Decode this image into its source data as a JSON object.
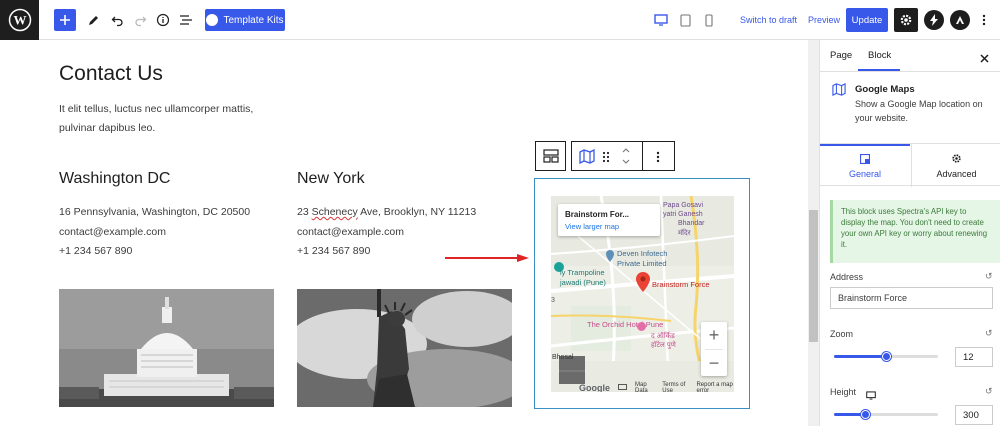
{
  "topbar": {
    "template_kits_label": "Template Kits",
    "switch_to_draft": "Switch to draft",
    "preview": "Preview",
    "update": "Update"
  },
  "content": {
    "title": "Contact Us",
    "intro": "It elit tellus, luctus nec ullamcorper mattis, pulvinar dapibus leo.",
    "locations": [
      {
        "name": "Washington DC",
        "address": "16 Pennsylvania, Washington, DC 20500",
        "email": "contact@example.com",
        "phone": "+1 234 567 890"
      },
      {
        "name": "New York",
        "address_prefix": "23 ",
        "address_word": "Schenecy",
        "address_suffix": " Ave, Brooklyn, NY 11213",
        "email": "contact@example.com",
        "phone": "+1 234 567 890"
      }
    ]
  },
  "map": {
    "place_name": "Brainstorm For...",
    "view_larger": "View larger map",
    "marker_label": "Brainstorm Force",
    "labels": {
      "area_top": "Papa Gosavi",
      "area_top2": "yatri Ganesh",
      "area_top3": "Bhandar",
      "area_top4": "मंदिर",
      "deven1": "Deven Infotech",
      "deven2": "Private Limited",
      "trampoline": "ly Trampoline",
      "jawadi": "jawadi (Pune)",
      "orchid": "The Orchid Hotel Pune",
      "orchid_mr1": "द ऑर्किड",
      "orchid_mr2": "हॉटेल पुणे",
      "bhosari": "Bhosal",
      "edge3": "3"
    },
    "footer": {
      "google": "Google",
      "map_data": "Map Data",
      "terms": "Terms of Use",
      "report": "Report a map error"
    },
    "zoom_in": "+",
    "zoom_out": "−"
  },
  "sidebar": {
    "tabs": {
      "page": "Page",
      "block": "Block"
    },
    "block_title": "Google Maps",
    "block_desc": "Show a Google Map location on your website.",
    "sec_general": "General",
    "sec_advanced": "Advanced",
    "notice": "This block uses Spectra's API key to display the map. You don't need to create your own API key or worry about renewing it.",
    "address_label": "Address",
    "address_value": "Brainstorm Force",
    "zoom_label": "Zoom",
    "zoom_value": "12",
    "zoom_fraction": 0.5,
    "height_label": "Height",
    "height_value": "300",
    "height_fraction": 0.3
  },
  "colors": {
    "accent": "#3858e9",
    "dark": "#1e1e1e",
    "block_border": "#3b8fc4",
    "arrow": "#e02424"
  }
}
